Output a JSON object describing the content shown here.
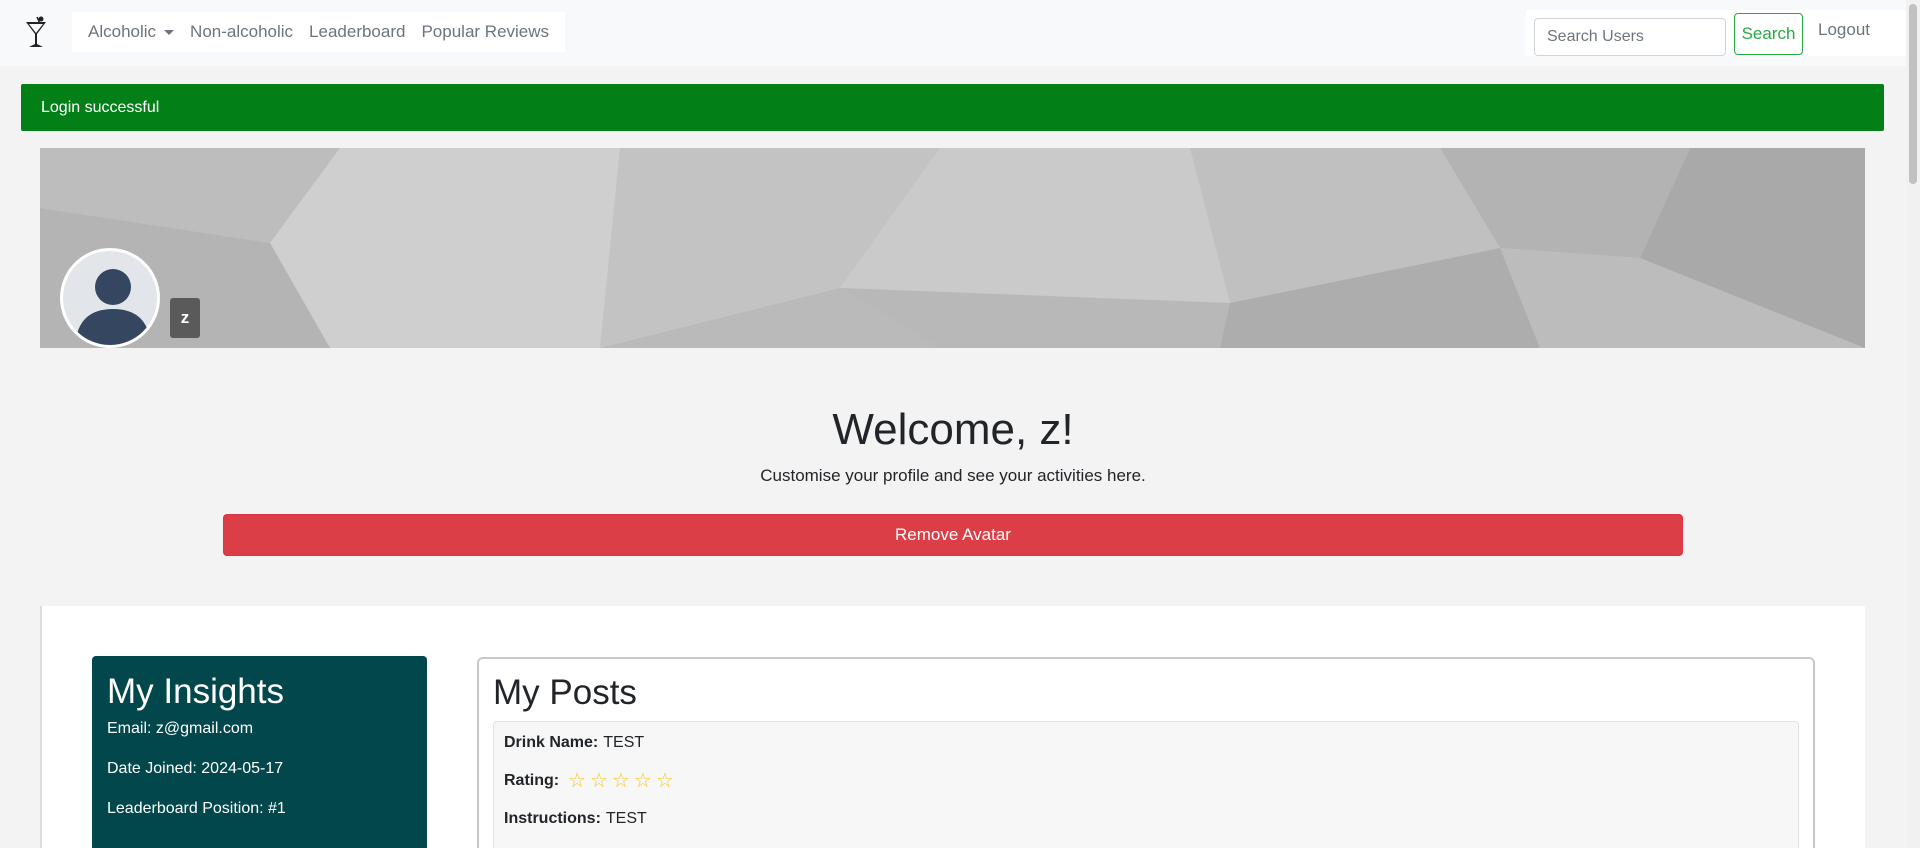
{
  "navbar": {
    "brand_icon": "cocktail-glass-icon",
    "links": {
      "alcoholic": "Alcoholic",
      "non_alcoholic": "Non-alcoholic",
      "leaderboard": "Leaderboard",
      "popular_reviews": "Popular Reviews"
    },
    "search_placeholder": "Search Users",
    "search_label": "Search",
    "logout_label": "Logout"
  },
  "alert": {
    "message": "Login successful",
    "color": "#028017"
  },
  "profile": {
    "username_badge": "z",
    "avatar_icon": "default-avatar-icon"
  },
  "welcome": {
    "title": "Welcome, z!",
    "subtitle": "Customise your profile and see your activities here.",
    "remove_avatar_label": "Remove Avatar"
  },
  "insights": {
    "title": "My Insights",
    "email": "Email: z@gmail.com",
    "date_joined": "Date Joined: 2024-05-17",
    "leaderboard_position": "Leaderboard Position: #1",
    "bg_color": "#01474c"
  },
  "posts": {
    "title": "My Posts",
    "items": [
      {
        "drink_name_label": "Drink Name:",
        "drink_name": "TEST",
        "rating_label": "Rating:",
        "rating": 0,
        "rating_max": 5,
        "instructions_label": "Instructions:",
        "instructions": "TEST"
      }
    ]
  },
  "colors": {
    "danger": "#dc3e47",
    "success": "#28a745",
    "star": "#f5c518"
  }
}
